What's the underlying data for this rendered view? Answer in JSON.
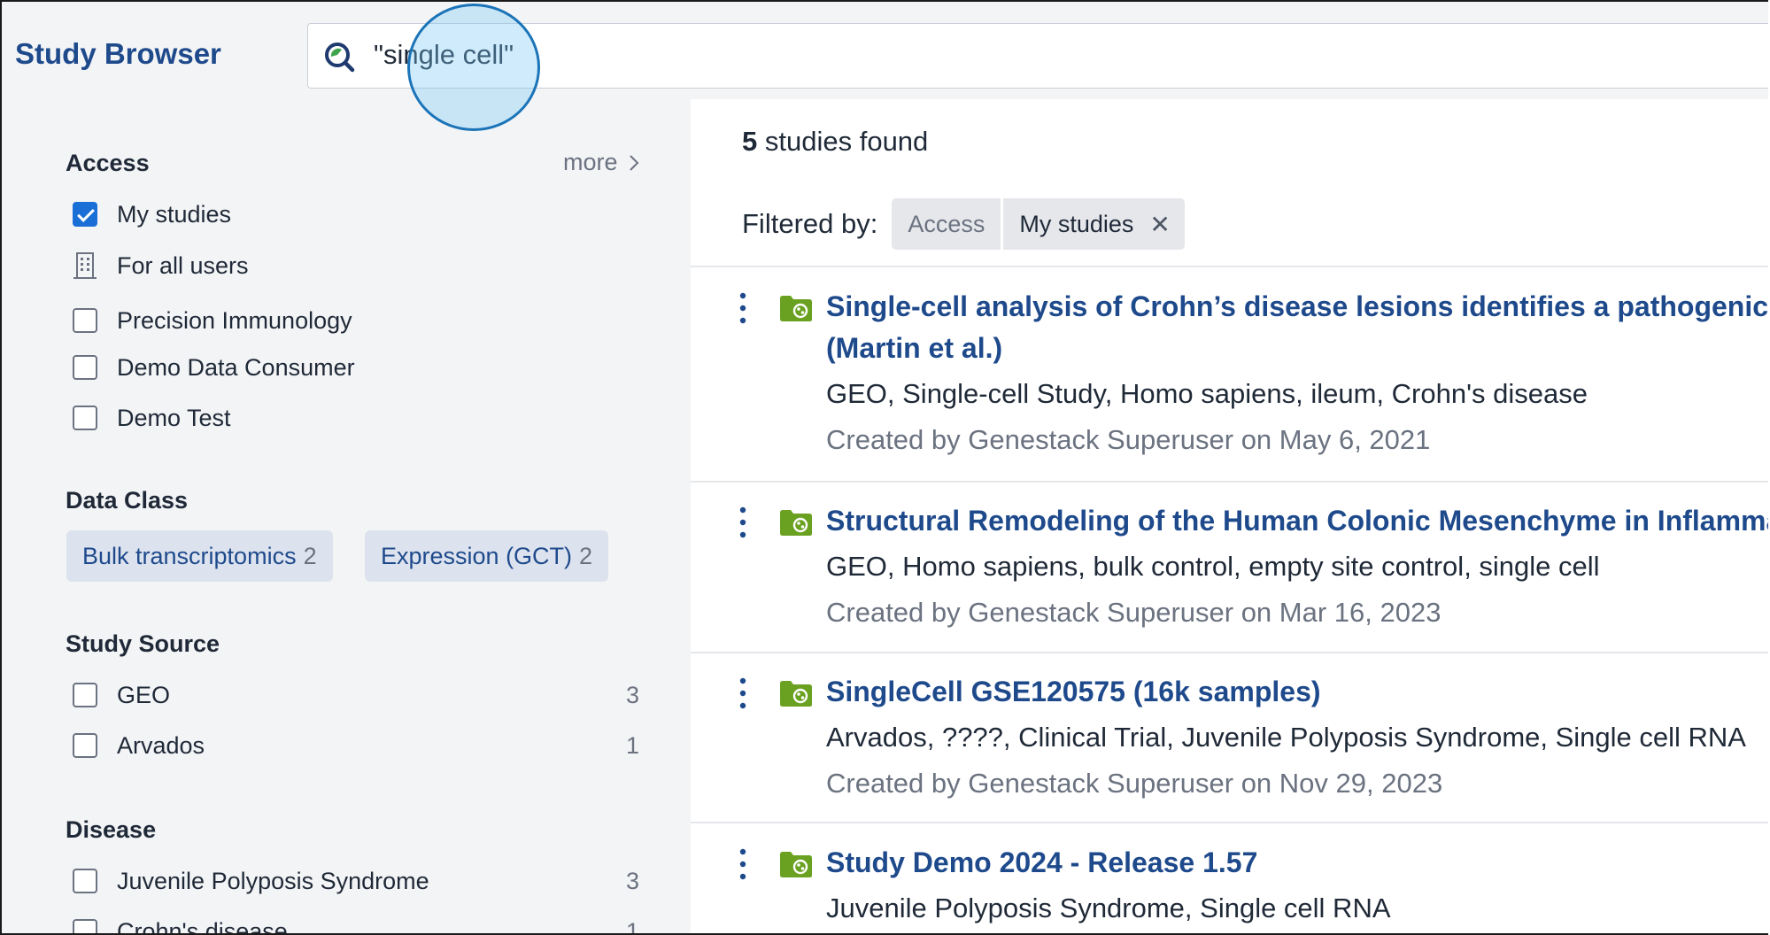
{
  "header": {
    "brand": "Study Browser",
    "search": {
      "value": "\"single cell\"",
      "placeholder": ""
    }
  },
  "sidebar": {
    "access": {
      "title": "Access",
      "more_label": "more",
      "items": [
        {
          "label": "My studies",
          "checked": true,
          "icon": "checkbox"
        },
        {
          "label": "For all users",
          "icon": "building-icon"
        },
        {
          "label": "Precision Immunology",
          "checked": false
        },
        {
          "label": "Demo Data Consumer",
          "checked": false
        },
        {
          "label": "Demo Test",
          "checked": false
        }
      ]
    },
    "data_class": {
      "title": "Data Class",
      "chips": [
        {
          "label": "Bulk transcriptomics",
          "count": "2"
        },
        {
          "label": "Expression (GCT)",
          "count": "2"
        }
      ]
    },
    "study_source": {
      "title": "Study Source",
      "items": [
        {
          "label": "GEO",
          "count": "3"
        },
        {
          "label": "Arvados",
          "count": "1"
        }
      ]
    },
    "disease": {
      "title": "Disease",
      "items": [
        {
          "label": "Juvenile Polyposis Syndrome",
          "count": "3"
        },
        {
          "label": "Crohn's disease",
          "count": "1"
        }
      ]
    }
  },
  "main": {
    "found_count": "5",
    "found_text": "studies found",
    "filtered_label": "Filtered by:",
    "filter": {
      "key": "Access",
      "value": "My studies",
      "remove": "✕"
    },
    "studies": [
      {
        "title": "Single-cell analysis of Crohn’s disease lesions identifies a pathogenic cellular module",
        "title_line2": "(Martin et al.)",
        "tags": "GEO, Single-cell Study, Homo sapiens, ileum, Crohn's disease",
        "created": "Created by Genestack Superuser on May 6, 2021"
      },
      {
        "title": "Structural Remodeling of the Human Colonic Mesenchyme in Inflammatory Bowel Disease",
        "tags": "GEO, Homo sapiens, bulk control, empty site control, single cell",
        "created": "Created by Genestack Superuser on Mar 16, 2023"
      },
      {
        "title": "SingleCell GSE120575 (16k samples)",
        "tags": "Arvados, ????, Clinical Trial, Juvenile Polyposis Syndrome, Single cell RNA",
        "created": "Created by Genestack Superuser on Nov 29, 2023"
      },
      {
        "title": "Study Demo 2024 - Release 1.57",
        "tags": "Juvenile Polyposis Syndrome, Single cell RNA",
        "created": ""
      }
    ]
  },
  "colors": {
    "accent": "#1e4a8c",
    "checkbox_checked": "#1a6fd6",
    "folder_green": "#6aa121",
    "sidebar_bg": "#f3f4f6"
  }
}
